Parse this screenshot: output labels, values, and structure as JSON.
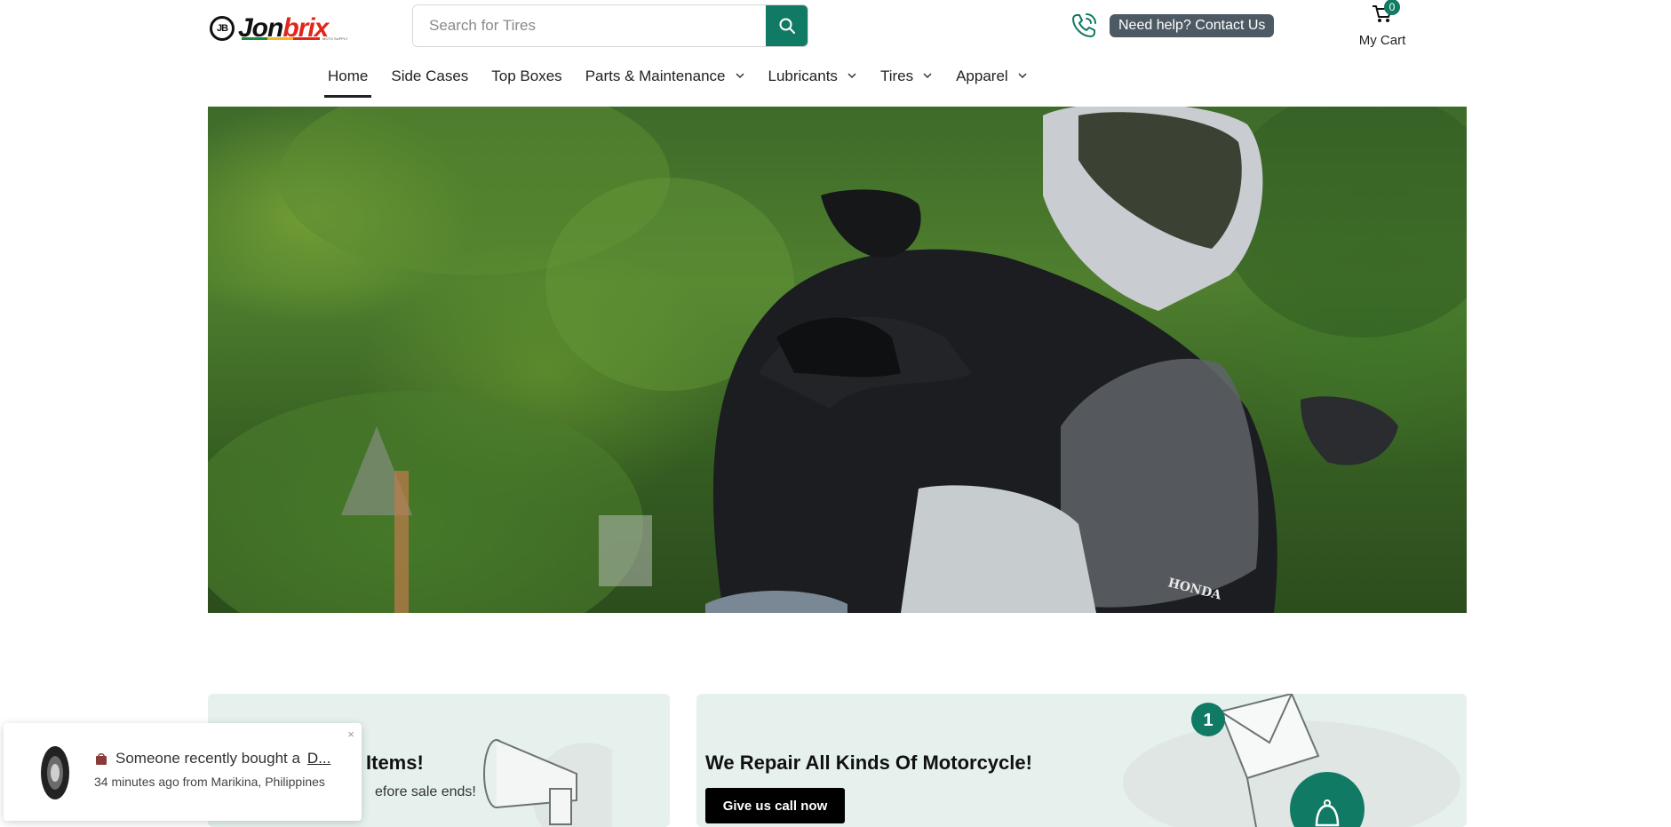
{
  "header": {
    "logo_text_a": "Jon",
    "logo_text_b": "brix",
    "logo_mark": "JB",
    "logo_sub": "MOTO SUPPLY",
    "search_placeholder": "Search for Tires",
    "help_label": "Need help? Contact Us",
    "cart_label": "My Cart",
    "cart_count": "0"
  },
  "nav": {
    "items": [
      {
        "label": "Home",
        "active": true
      },
      {
        "label": "Side Cases"
      },
      {
        "label": "Top Boxes"
      },
      {
        "label": "Parts & Maintenance",
        "dropdown": true
      },
      {
        "label": "Lubricants",
        "dropdown": true
      },
      {
        "label": "Tires",
        "dropdown": true
      },
      {
        "label": "Apparel",
        "dropdown": true
      }
    ]
  },
  "hero": {
    "windshield_brand": "HONDA"
  },
  "promos": {
    "left_title": "Items!",
    "left_sub": "efore sale ends!",
    "right_title": "We Repair All Kinds Of Motorcycle!",
    "right_button": "Give us call now",
    "notification_badge": "1"
  },
  "toast": {
    "message_prefix": "Someone recently bought a",
    "product": "D...",
    "meta": "34 minutes ago from Marikina, Philippines",
    "close": "×"
  },
  "colors": {
    "accent": "#117a65",
    "help_pill": "#4d5a63",
    "promo_bg": "#e6f1ee"
  },
  "icons": {
    "search": "search-icon",
    "phone": "phone-icon",
    "cart": "cart-icon",
    "chevron": "chevron-down-icon",
    "close": "close-icon",
    "bag": "shopping-bag-icon",
    "bell": "bell-icon",
    "megaphone": "megaphone-icon",
    "envelope": "envelope-icon"
  }
}
